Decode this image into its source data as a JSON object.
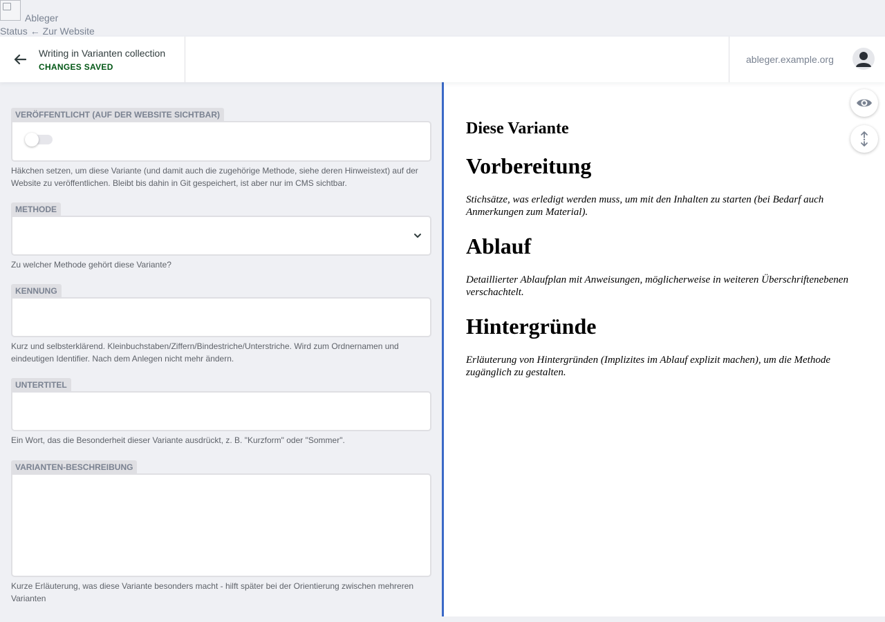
{
  "topbar": {
    "brand": "Ableger",
    "status_label": "Status",
    "back_to_site": "← Zur Website"
  },
  "toolbar": {
    "collection_title": "Writing in Varianten collection",
    "save_state": "CHANGES SAVED",
    "site_url": "ableger.example.org"
  },
  "editor": {
    "published": {
      "label": "Veröffentlicht (auf der Website sichtbar)",
      "checked": false,
      "hint": "Häkchen setzen, um diese Variante (und damit auch die zugehörige Methode, siehe deren Hinweistext) auf der Website zu veröffentlichen. Bleibt bis dahin in Git gespeichert, ist aber nur im CMS sichtbar."
    },
    "method": {
      "label": "Methode",
      "value": "",
      "hint": "Zu welcher Methode gehört diese Variante?"
    },
    "identifier": {
      "label": "Kennung",
      "value": "",
      "hint": "Kurz und selbsterklärend. Kleinbuchstaben/Ziffern/Bindestriche/Unterstriche. Wird zum Ordnernamen und eindeutigen Identifier. Nach dem Anlegen nicht mehr ändern."
    },
    "subtitle": {
      "label": "Untertitel",
      "value": "",
      "hint": "Ein Wort, das die Besonderheit dieser Variante ausdrückt, z. B. \"Kurzform\" oder \"Sommer\"."
    },
    "description": {
      "label": "Varianten-Beschreibung",
      "value": "",
      "hint": "Kurze Erläuterung, was diese Variante besonders macht - hilft später bei der Orientierung zwischen mehreren Varianten"
    }
  },
  "preview": {
    "title": "Diese Variante",
    "sections": [
      {
        "heading": "Vorbereitung",
        "text": "Stichsätze, was erledigt werden muss, um mit den Inhalten zu starten (bei Bedarf auch Anmerkungen zum Material)."
      },
      {
        "heading": "Ablauf",
        "text": "Detaillierter Ablaufplan mit Anweisungen, möglicherweise in weiteren Überschriftenebenen verschachtelt."
      },
      {
        "heading": "Hintergründe",
        "text": "Erläuterung von Hintergründen (Implizites im Ablauf explizit machen), um die Methode zugänglich zu gestalten."
      }
    ]
  },
  "icons": {
    "back": "arrow-left-icon",
    "avatar": "user-avatar-icon",
    "preview_toggle": "eye-icon",
    "scroll_sync": "sync-scroll-icon",
    "select": "chevron-down-icon"
  },
  "colors": {
    "saved": "#005614",
    "divider": "#3a69c7",
    "label_bg": "#dfdfe3"
  }
}
